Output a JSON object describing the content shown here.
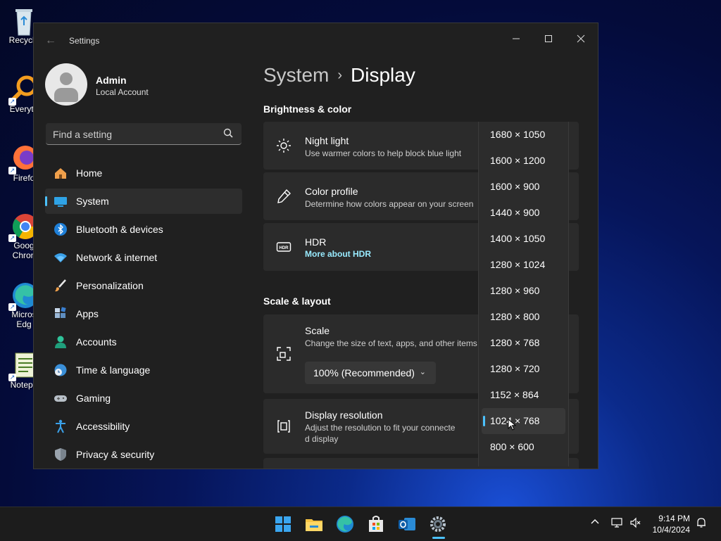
{
  "desktop": {
    "icons": [
      {
        "label": "Recycle",
        "icon": "recycle-bin-icon"
      },
      {
        "label": "Everyth",
        "icon": "everything-search-icon"
      },
      {
        "label": "Firefo",
        "icon": "firefox-icon"
      },
      {
        "label": "Goog",
        "label2": "Chron",
        "icon": "chrome-icon"
      },
      {
        "label": "Micros",
        "label2": "Edg",
        "icon": "edge-icon"
      },
      {
        "label": "Notepa",
        "icon": "notepad-icon"
      }
    ]
  },
  "window": {
    "title": "Settings",
    "controls": [
      "minimize",
      "maximize",
      "close"
    ]
  },
  "user": {
    "name": "Admin",
    "account_type": "Local Account"
  },
  "search": {
    "placeholder": "Find a setting"
  },
  "sidebar": {
    "items": [
      {
        "label": "Home",
        "icon": "home-icon"
      },
      {
        "label": "System",
        "icon": "system-icon",
        "active": true
      },
      {
        "label": "Bluetooth & devices",
        "icon": "bluetooth-icon"
      },
      {
        "label": "Network & internet",
        "icon": "wifi-icon"
      },
      {
        "label": "Personalization",
        "icon": "brush-icon"
      },
      {
        "label": "Apps",
        "icon": "apps-icon"
      },
      {
        "label": "Accounts",
        "icon": "accounts-icon"
      },
      {
        "label": "Time & language",
        "icon": "globe-clock-icon"
      },
      {
        "label": "Gaming",
        "icon": "gamepad-icon"
      },
      {
        "label": "Accessibility",
        "icon": "accessibility-icon"
      },
      {
        "label": "Privacy & security",
        "icon": "shield-icon"
      }
    ]
  },
  "breadcrumb": {
    "parent": "System",
    "separator": "›",
    "current": "Display"
  },
  "sections": {
    "brightness": "Brightness & color",
    "scale_layout": "Scale & layout"
  },
  "cards": {
    "night_light": {
      "title": "Night light",
      "subtitle": "Use warmer colors to help block blue light",
      "icon": "sun-icon"
    },
    "color_profile": {
      "title": "Color profile",
      "subtitle": "Determine how colors appear on your screen",
      "icon": "eyedropper-icon"
    },
    "hdr": {
      "title": "HDR",
      "link": "More about HDR",
      "icon": "hdr-icon"
    },
    "scale": {
      "title": "Scale",
      "subtitle": "Change the size of text, apps, and other items",
      "value": "100% (Recommended)",
      "icon": "scale-icon"
    },
    "resolution": {
      "title": "Display resolution",
      "subtitle_line1": "Adjust the resolution to fit your connecte",
      "subtitle_line2": "d display",
      "icon": "resolution-icon"
    }
  },
  "resolution_options": [
    "1680 × 1050",
    "1600 × 1200",
    "1600 × 900",
    "1440 × 900",
    "1400 × 1050",
    "1280 × 1024",
    "1280 × 960",
    "1280 × 800",
    "1280 × 768",
    "1280 × 720",
    "1152 × 864",
    "1024 × 768",
    "800 × 600"
  ],
  "selected_resolution": "1024 × 768",
  "taskbar": {
    "apps": [
      "start-icon",
      "file-explorer-icon",
      "edge-icon",
      "store-icon",
      "outlook-icon",
      "settings-icon"
    ],
    "time": "9:14 PM",
    "date": "10/4/2024"
  },
  "colors": {
    "accent": "#4cc2ff",
    "link": "#99ebff",
    "window_bg": "#202020",
    "card_bg": "#2b2b2b"
  }
}
